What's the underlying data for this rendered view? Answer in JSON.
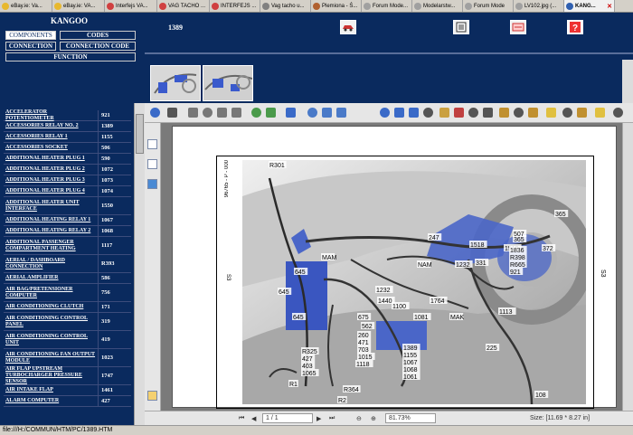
{
  "tabs": [
    {
      "label": "eBay.ie: Va...",
      "color": "#e8b82e"
    },
    {
      "label": "eBay.ie: VA...",
      "color": "#e8b82e"
    },
    {
      "label": "Interfejs VA...",
      "color": "#d04040"
    },
    {
      "label": "VAG TACHO ...",
      "color": "#d04040"
    },
    {
      "label": "INTERFEJS ...",
      "color": "#d04040"
    },
    {
      "label": "Vag tacho u...",
      "color": "#808080"
    },
    {
      "label": "Plemiona - Ś...",
      "color": "#b06030"
    },
    {
      "label": "Forum Mode...",
      "color": "#a0a0a0"
    },
    {
      "label": "Modelarstw...",
      "color": "#a0a0a0"
    },
    {
      "label": "Forum Mode",
      "color": "#a0a0a0"
    },
    {
      "label": "LV102.jpg (...",
      "color": "#a0a0a0"
    },
    {
      "label": "KANG...",
      "color": "#3060b0"
    }
  ],
  "menu": {
    "title": "KANGOO",
    "components": "COMPONENTS",
    "codes": "CODES",
    "connection": "CONNECTION",
    "connection_code": "CONNECTION CODE",
    "function": "FUNCTION"
  },
  "header": {
    "code": "1389"
  },
  "components": [
    {
      "name": "ACCELERATOR POTENTIOMETER",
      "code": "921"
    },
    {
      "name": "ACCESSORIES RELAY NO. 2",
      "code": "1389"
    },
    {
      "name": "ACCESSORIES RELAY 1",
      "code": "1155"
    },
    {
      "name": "ACCESSORIES SOCKET",
      "code": "506"
    },
    {
      "name": "ADDITIONAL HEATER PLUG 1",
      "code": "590"
    },
    {
      "name": "ADDITIONAL HEATER PLUG 2",
      "code": "1072"
    },
    {
      "name": "ADDITIONAL HEATER PLUG 3",
      "code": "1073"
    },
    {
      "name": "ADDITIONAL HEATER PLUG 4",
      "code": "1074"
    },
    {
      "name": "ADDITIONAL HEATER UNIT INTERFACE",
      "code": "1550"
    },
    {
      "name": "ADDITIONAL HEATING RELAY 1",
      "code": "1067"
    },
    {
      "name": "ADDITIONAL HEATING RELAY 2",
      "code": "1068"
    },
    {
      "name": "ADDITIONAL PASSENGER COMPARTMENT HEATING",
      "code": "1117"
    },
    {
      "name": "AERIAL / DASHBOARD CONNECTION",
      "code": "R393"
    },
    {
      "name": "AERIAL AMPLIFIER",
      "code": "586"
    },
    {
      "name": "AIR BAG/PRETENSIONER COMPUTER",
      "code": "756"
    },
    {
      "name": "AIR CONDITIONING CLUTCH",
      "code": "171"
    },
    {
      "name": "AIR CONDITIONING CONTROL PANEL",
      "code": "319"
    },
    {
      "name": "AIR CONDITIONING CONTROL UNIT",
      "code": "419"
    },
    {
      "name": "AIR CONDITIONING FAN OUTPUT MODULE",
      "code": "1023"
    },
    {
      "name": "AIR FLAP UPSTREAM TURBOCHARGER PRESSURE SENSOR",
      "code": "1747"
    },
    {
      "name": "AIR INTAKE FLAP",
      "code": "1461"
    },
    {
      "name": "ALARM COMPUTER",
      "code": "427"
    }
  ],
  "viewer": {
    "page_display": "1 / 1",
    "zoom": "81.73%",
    "size": "Size: [11.69 * 8.27 in]"
  },
  "diagram": {
    "ref": "96765 - P - 000",
    "left_mark": "S3",
    "right_mark": "S3",
    "labels": [
      "R301",
      "365",
      "247",
      "NAM",
      "MAM",
      "645",
      "645",
      "645",
      "1232",
      "1440",
      "1100",
      "1764",
      "1081",
      "562",
      "675",
      "260",
      "471",
      "703",
      "1015",
      "1118",
      "1389",
      "1155",
      "1067",
      "1068",
      "1061",
      "R325",
      "427",
      "403",
      "1065",
      "R1",
      "R364",
      "R2",
      "1232",
      "1518",
      "1519",
      "1836",
      "R398",
      "R665",
      "921",
      "MAK",
      "1113",
      "225",
      "108",
      "331",
      "365",
      "372",
      "507"
    ]
  },
  "browser_status": "file:///H:/COMMUN/HTM/PC/1389.HTM"
}
